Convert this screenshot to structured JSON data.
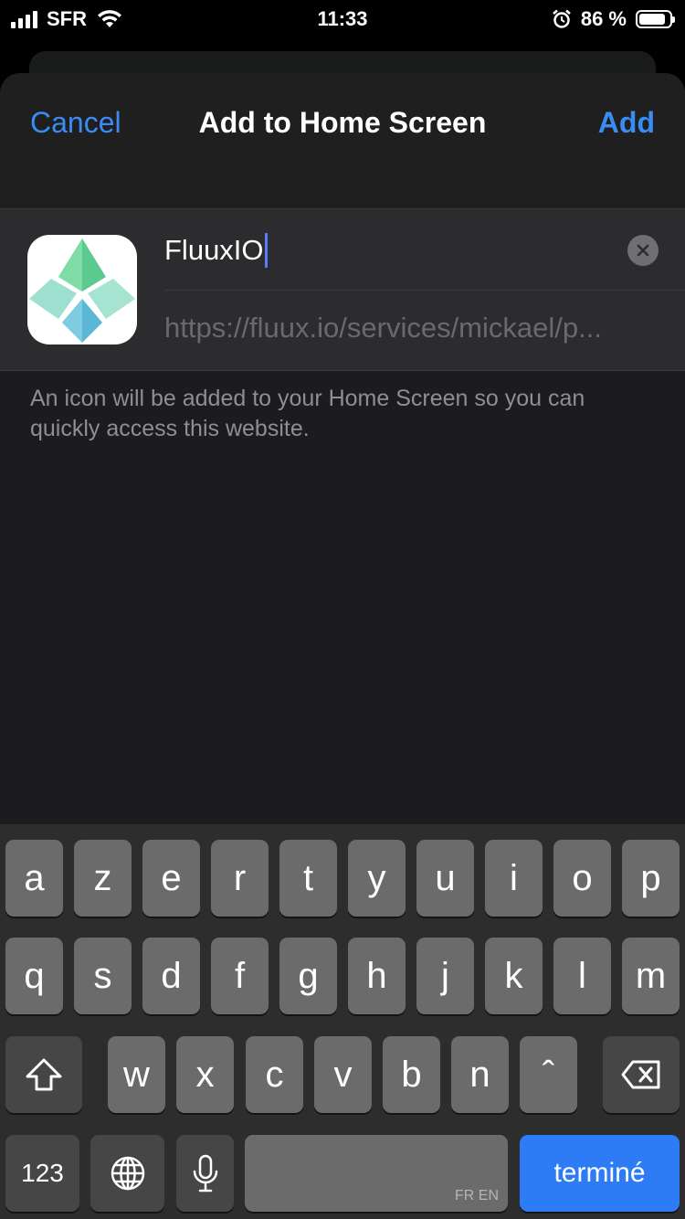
{
  "status_bar": {
    "carrier": "SFR",
    "time": "11:33",
    "battery": "86 %",
    "battery_level": 0.86,
    "icons": [
      "signal-icon",
      "wifi-icon",
      "alarm-icon",
      "battery-icon"
    ]
  },
  "header": {
    "cancel_label": "Cancel",
    "title": "Add to Home Screen",
    "add_label": "Add"
  },
  "form": {
    "name_value": "FluuxIO",
    "url_value": "https://fluux.io/services/mickael/p...",
    "note": "An icon will be added to your Home Screen so you can quickly access this website."
  },
  "keyboard": {
    "row1": [
      "a",
      "z",
      "e",
      "r",
      "t",
      "y",
      "u",
      "i",
      "o",
      "p"
    ],
    "row2": [
      "q",
      "s",
      "d",
      "f",
      "g",
      "h",
      "j",
      "k",
      "l",
      "m"
    ],
    "row3": [
      "w",
      "x",
      "c",
      "v",
      "b",
      "n",
      "ˆ"
    ],
    "numbers_label": "123",
    "space_lang": "FR EN",
    "done_label": "terminé"
  },
  "colors": {
    "accent": "#3b8bf5",
    "done_key": "#2d7cf6",
    "sheet_bg": "#1c1c1e",
    "group_bg": "#2c2c2e"
  }
}
